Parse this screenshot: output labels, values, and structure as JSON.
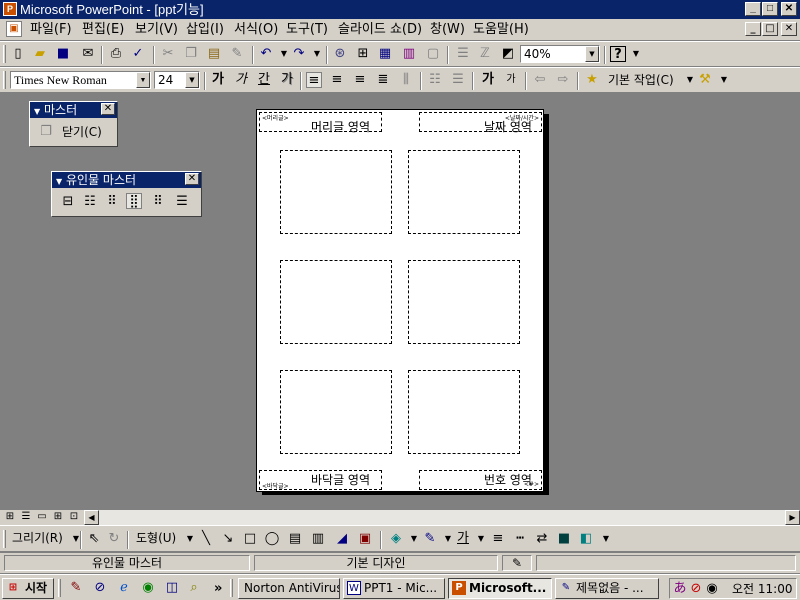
{
  "window": {
    "title": "Microsoft PowerPoint - [ppt기능]",
    "min": "_",
    "max": "□",
    "close": "✕"
  },
  "menu": [
    {
      "label": "파일(F)"
    },
    {
      "label": "편집(E)"
    },
    {
      "label": "보기(V)"
    },
    {
      "label": "삽입(I)"
    },
    {
      "label": "서식(O)"
    },
    {
      "label": "도구(T)"
    },
    {
      "label": "슬라이드 쇼(D)"
    },
    {
      "label": "창(W)"
    },
    {
      "label": "도움말(H)"
    }
  ],
  "standard_toolbar": {
    "zoom": "40%",
    "help": "?"
  },
  "format_toolbar": {
    "font": "Times New Roman",
    "size": "24",
    "bold": "가",
    "italic": "가",
    "underline": "간",
    "shadow": "가",
    "grow_font": "가",
    "shrink_font": "가",
    "design": "기본 작업(C)"
  },
  "master_palette": {
    "title": "마스터",
    "close": "닫기(C)"
  },
  "handout_palette": {
    "title": "유인물 마스터"
  },
  "page": {
    "header": "머리글 영역",
    "date": "날짜 영역",
    "footer": "바닥글 영역",
    "number": "번호 영역",
    "header_tag": "<머리글>",
    "date_tag": "<날짜/시간>",
    "footer_tag": "<바닥글>",
    "number_tag": "<#>"
  },
  "draw_toolbar": {
    "draw": "그리기(R)",
    "autoshape": "도형(U)",
    "font_color_glyph": "가"
  },
  "status_bar": {
    "view": "유인물 마스터",
    "design": "기본 디자인"
  },
  "taskbar": {
    "start": "시작",
    "more": "»",
    "tasks": [
      {
        "label": "Norton AntiVirus",
        "icon": "N"
      },
      {
        "label": "PPT1 - Mic...",
        "icon": "W"
      },
      {
        "label": "Microsoft...",
        "icon": "P"
      },
      {
        "label": "제목없음 - ...",
        "icon": "✎"
      }
    ],
    "clock": "오전 11:00"
  },
  "colors": {
    "titlebar": "#0a246a",
    "chrome": "#d4d0c8",
    "workspace": "#808080"
  }
}
